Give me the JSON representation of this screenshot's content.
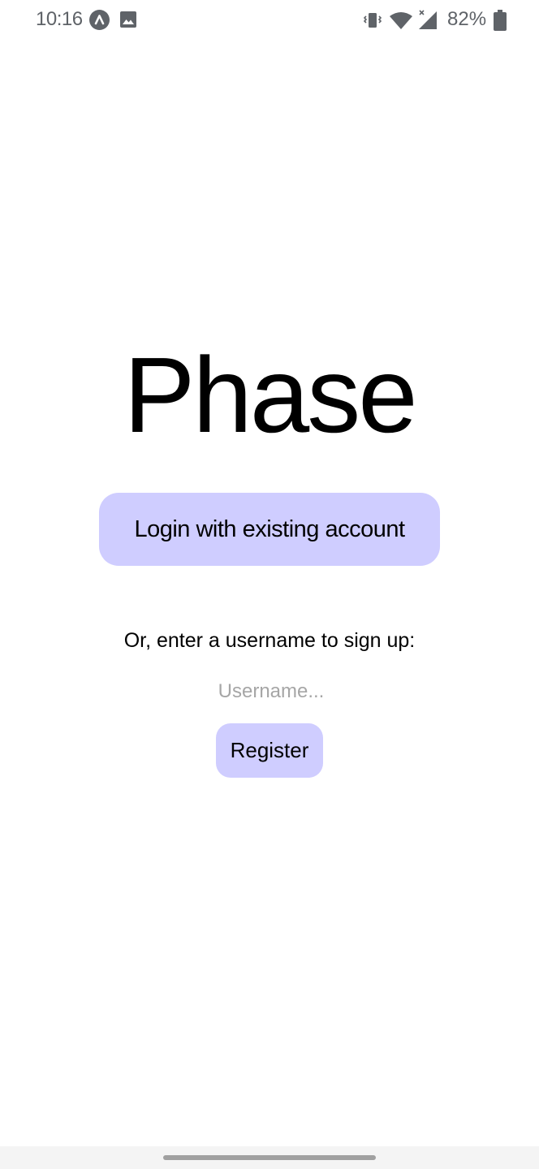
{
  "status_bar": {
    "time": "10:16",
    "battery_percent": "82%",
    "icon_color": "#5f6368",
    "icons": [
      "app-notification-icon",
      "image-icon",
      "vibrate-icon",
      "wifi-icon",
      "signal-icon",
      "battery-icon"
    ]
  },
  "main": {
    "title": "Phase",
    "login_button_label": "Login with existing account",
    "signup_prompt": "Or, enter a username to sign up:",
    "username_placeholder": "Username...",
    "username_value": "",
    "register_button_label": "Register"
  },
  "colors": {
    "button_bg": "#cfcdff",
    "text": "#000000",
    "placeholder": "#a6a6a6",
    "background": "#ffffff"
  }
}
